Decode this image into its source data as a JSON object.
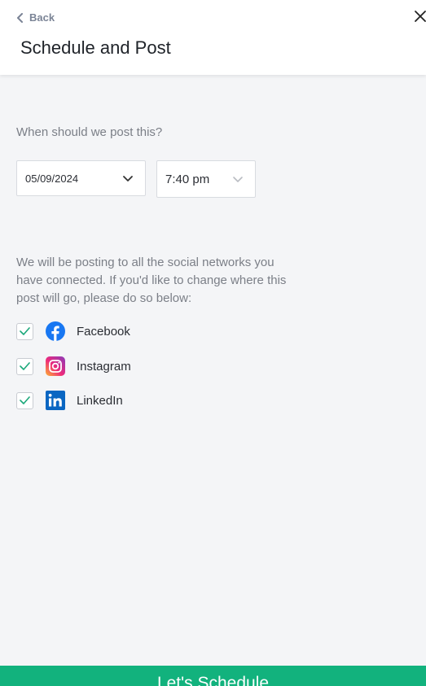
{
  "header": {
    "back_label": "Back",
    "title": "Schedule and Post"
  },
  "schedule": {
    "question": "When should we post this?",
    "date_value": "05/09/2024",
    "time_value": "7:40 pm"
  },
  "networks": {
    "info_text": "We will be posting to all the social networks you have connected. If you'd like to change where this post will go, please do so below:",
    "items": [
      {
        "label": "Facebook",
        "checked": true,
        "icon": "facebook-icon"
      },
      {
        "label": "Instagram",
        "checked": true,
        "icon": "instagram-icon"
      },
      {
        "label": "LinkedIn",
        "checked": true,
        "icon": "linkedin-icon"
      }
    ]
  },
  "footer": {
    "schedule_label": "Let's Schedule"
  },
  "colors": {
    "accent": "#12b27d",
    "check": "#1ba87a",
    "facebook": "#1877f2",
    "linkedin": "#0a66c2"
  }
}
